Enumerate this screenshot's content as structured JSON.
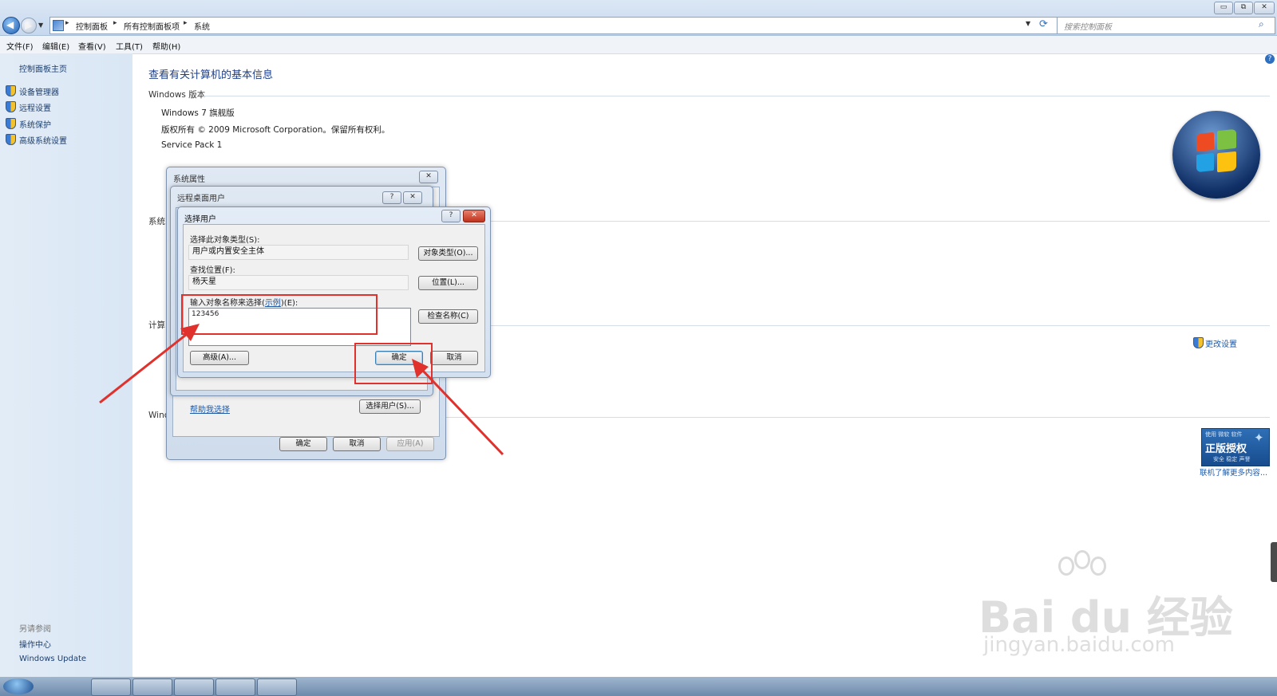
{
  "window": {
    "min_label": "▭",
    "max_label": "⧉",
    "close_label": "✕"
  },
  "address": {
    "breadcrumbs": [
      "控制面板",
      "所有控制面板项",
      "系统"
    ],
    "search_placeholder": "搜索控制面板"
  },
  "menu": [
    "文件(F)",
    "编辑(E)",
    "查看(V)",
    "工具(T)",
    "帮助(H)"
  ],
  "sidebar": {
    "home": "控制面板主页",
    "items": [
      "设备管理器",
      "远程设置",
      "系统保护",
      "高级系统设置"
    ],
    "see_also_title": "另请参阅",
    "see_also": [
      "操作中心",
      "Windows Update"
    ]
  },
  "main": {
    "title": "查看有关计算机的基本信息",
    "edition_header": "Windows 版本",
    "edition": "Windows 7 旗舰版",
    "copyright": "版权所有 © 2009 Microsoft Corporation。保留所有权利。",
    "service_pack": "Service Pack 1",
    "system_header": "系统",
    "computer_header": "计算",
    "activation_header": "Winc",
    "change_settings": "更改设置",
    "genuine_badge_small": "使用 微软 软件",
    "genuine_badge_big": "正版授权",
    "genuine_badge_sub": "安全 稳定 声誉",
    "genuine_link": "联机了解更多内容..."
  },
  "dialog_sysprops": {
    "title": "系统属性",
    "ok": "确定",
    "cancel": "取消",
    "apply": "应用(A)"
  },
  "dialog_rdusers": {
    "title": "远程桌面用户",
    "help_link": "帮助我选择",
    "select_users": "选择用户(S)...",
    "ok_hidden": "确定",
    "cancel_hidden": "取消"
  },
  "dialog_select": {
    "title": "选择用户",
    "object_type_label": "选择此对象类型(S):",
    "object_type_value": "用户或内置安全主体",
    "object_type_btn": "对象类型(O)...",
    "location_label": "查找位置(F):",
    "location_value": "杨天星",
    "location_btn": "位置(L)...",
    "names_label_pre": "输入对象名称来选择(",
    "names_label_link": "示例",
    "names_label_post": ")(E):",
    "names_value": "123456",
    "check_names_btn": "检查名称(C)",
    "advanced_btn": "高级(A)...",
    "ok": "确定",
    "cancel": "取消"
  },
  "watermark": {
    "brand": "Bai  du 经验",
    "url": "jingyan.baidu.com"
  },
  "colors": {
    "link": "#1e5aa8",
    "annotation": "#e0312d",
    "sidebar": "#dde8f5"
  }
}
